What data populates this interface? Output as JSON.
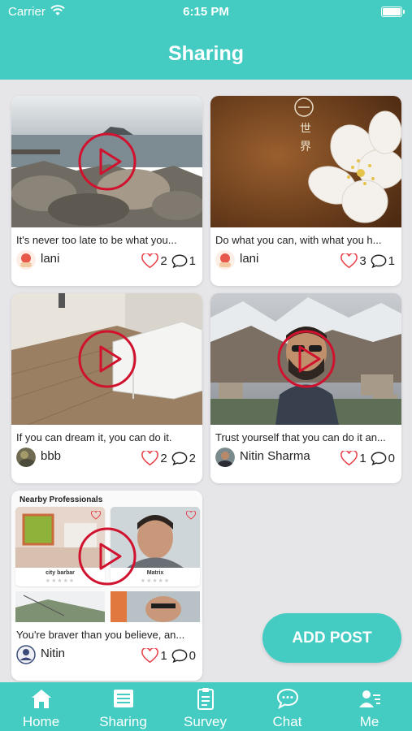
{
  "status": {
    "carrier": "Carrier",
    "time": "6:15 PM"
  },
  "header": {
    "title": "Sharing"
  },
  "posts": [
    {
      "caption": "It's never too late to be what you...",
      "author": "lani",
      "likes": "2",
      "comments": "1",
      "has_video": true
    },
    {
      "caption": "Do what you can, with what you h...",
      "author": "lani",
      "likes": "3",
      "comments": "1",
      "has_video": false,
      "overlay_text": [
        "世",
        "界"
      ]
    },
    {
      "caption": "If you can dream it, you can do it.",
      "author": "bbb",
      "likes": "2",
      "comments": "2",
      "has_video": true
    },
    {
      "caption": "Trust yourself that you can do it an...",
      "author": "Nitin Sharma",
      "likes": "1",
      "comments": "0",
      "has_video": true
    },
    {
      "caption": "You're braver than you believe, an...",
      "author": "Nitin",
      "likes": "1",
      "comments": "0",
      "has_video": true,
      "nearby": {
        "title": "Nearby Professionals",
        "tiles": [
          {
            "name": "city barbar",
            "stars": "★★★★★"
          },
          {
            "name": "Matrix",
            "stars": "★★★★★"
          }
        ]
      }
    }
  ],
  "add_post": {
    "label": "ADD POST"
  },
  "tabs": [
    {
      "label": "Home",
      "icon": "home-icon"
    },
    {
      "label": "Sharing",
      "icon": "list-icon"
    },
    {
      "label": "Survey",
      "icon": "clipboard-icon"
    },
    {
      "label": "Chat",
      "icon": "chat-icon"
    },
    {
      "label": "Me",
      "icon": "profile-icon"
    }
  ],
  "colors": {
    "accent": "#44ccc3",
    "play": "#d0122e",
    "heart": "#e8424a"
  }
}
